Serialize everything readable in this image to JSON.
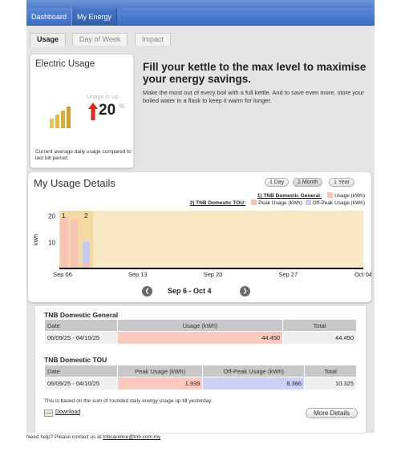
{
  "nav": {
    "items": [
      {
        "label": "Dashboard"
      },
      {
        "label": "My Energy"
      }
    ]
  },
  "tabs": [
    {
      "label": "Usage"
    },
    {
      "label": "Day of Week"
    },
    {
      "label": "Impact"
    }
  ],
  "electric_usage": {
    "title": "Electric Usage",
    "trend_label": "Usage is up",
    "percent_value": "20",
    "percent_sign": "%",
    "description": "Current average daily usage compared to last bill period."
  },
  "tip": {
    "title": "Fill your kettle to the max level to maximise your energy savings.",
    "body": "Make the most out of every boil with a full kettle. And to save even more, store your boiled water in a flask to keep it warm for longer."
  },
  "details": {
    "title": "My Usage Details",
    "range_buttons": [
      {
        "label": "1 Day"
      },
      {
        "label": "1 Month"
      },
      {
        "label": "1 Year"
      }
    ],
    "legend": {
      "plan1_title": "1) TNB Domestic General:",
      "plan1_item": "Usage (kWh)",
      "plan2_title": "2) TNB Domestic TOU:",
      "plan2_peak": "Peak Usage (kWh)",
      "plan2_off": "Off-Peak Usage (kWh)"
    },
    "period_label": "Sep 6 - Oct 4",
    "prev_icon": "chevron-left-icon",
    "next_icon": "chevron-right-icon"
  },
  "chart_data": {
    "type": "bar",
    "ylabel": "kWh",
    "ylim": [
      0,
      22
    ],
    "yticks": [
      10,
      20
    ],
    "xticks": [
      "Sep 06",
      "Sep 13",
      "Sep 20",
      "Sep 27",
      "Oct 04"
    ],
    "bar_group_labels": [
      "1",
      "2"
    ],
    "series": [
      {
        "name": "Usage (kWh)",
        "color": "#f7c2b8",
        "values": [
          19.5,
          18.5
        ]
      },
      {
        "name": "Peak Usage (kWh)",
        "color": "#f7c2b8",
        "values": [
          1.939
        ]
      },
      {
        "name": "Off-Peak Usage (kWh)",
        "color": "#c9c8f5",
        "values": [
          8.386
        ]
      }
    ],
    "colors": {
      "highlight": "#f6e4b8",
      "axis": "#111111"
    }
  },
  "table_general": {
    "title": "TNB Domestic General",
    "headers": [
      "Date",
      "Usage (kWh)",
      "Total"
    ],
    "rows": [
      {
        "date": "06/09/25 - 04/10/25",
        "usage": "44.450",
        "total": "44.450"
      }
    ]
  },
  "table_tou": {
    "title": "TNB Domestic TOU",
    "headers": [
      "Date",
      "Peak Usage (kWh)",
      "Off-Peak Usage (kWh)",
      "Total"
    ],
    "rows": [
      {
        "date": "06/09/25 - 04/10/25",
        "peak": "1.939",
        "offpeak": "8.386",
        "total": "10.325"
      }
    ]
  },
  "footer_note": "This is based on the sum of rounded daily energy usage up till yesterday.",
  "download_label": "Download",
  "download_icon": "csv-icon",
  "csv_text": "CSV",
  "more_details_label": "More Details",
  "help": {
    "text": "Need help? Please contact us at",
    "email": "tnbcareline@tnb.com.my"
  }
}
